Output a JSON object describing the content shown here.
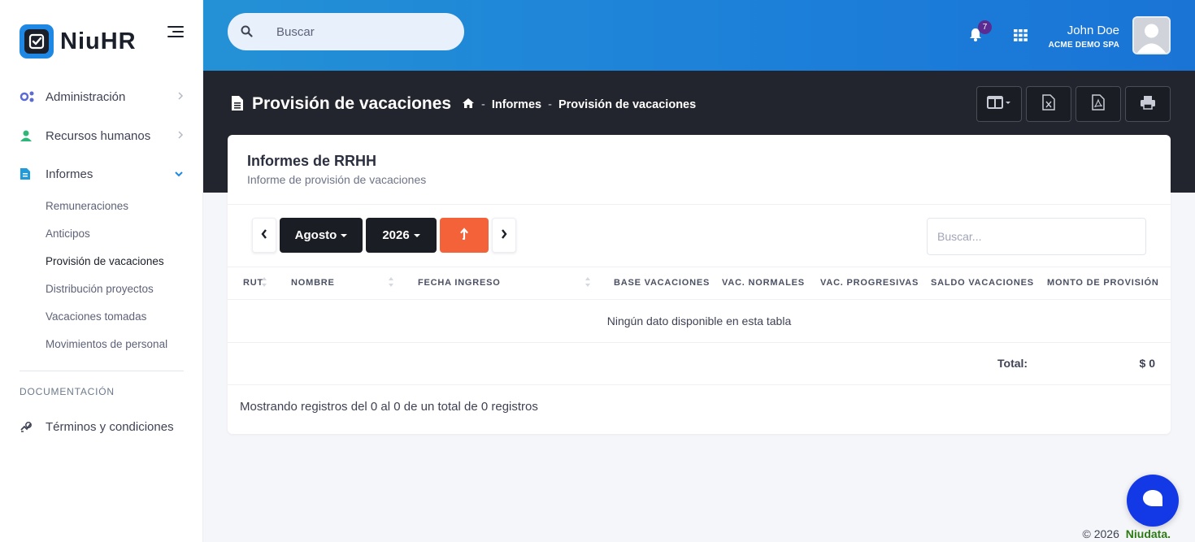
{
  "brand": {
    "name": "NiuHR"
  },
  "search": {
    "placeholder": "Buscar"
  },
  "notifications": {
    "count": "7"
  },
  "user": {
    "name": "John Doe",
    "company": "ACME DEMO SPA"
  },
  "sidebar": {
    "items": [
      {
        "label": "Administración",
        "icon": "gears-icon"
      },
      {
        "label": "Recursos humanos",
        "icon": "user-icon"
      },
      {
        "label": "Informes",
        "icon": "file-icon"
      }
    ],
    "subitems": [
      "Remuneraciones",
      "Anticipos",
      "Provisión de vacaciones",
      "Distribución proyectos",
      "Vacaciones tomadas",
      "Movimientos de personal"
    ],
    "active_subitem": "Provisión de vacaciones",
    "section_title": "DOCUMENTACIÓN",
    "doc_item": "Términos y condiciones"
  },
  "page": {
    "title": "Provisión de vacaciones",
    "breadcrumb": [
      "Informes",
      "Provisión de vacaciones"
    ]
  },
  "card": {
    "title": "Informes de RRHH",
    "subtitle": "Informe de provisión de vacaciones"
  },
  "period": {
    "month": "Agosto",
    "year": "2026"
  },
  "table": {
    "filter_placeholder": "Buscar...",
    "columns": [
      "RUT",
      "NOMBRE",
      "FECHA INGRESO",
      "BASE VACACIONES",
      "VAC. NORMALES",
      "VAC. PROGRESIVAS",
      "SALDO VACACIONES",
      "MONTO DE PROVISIÓN"
    ],
    "empty_message": "Ningún dato disponible en esta tabla",
    "total_label": "Total:",
    "total_value": "$ 0",
    "info": "Mostrando registros del 0 al 0 de un total de 0 registros"
  },
  "footer": {
    "copyright": "© 2026",
    "brand": "Niudata."
  },
  "colors": {
    "accent": "#1f88e5",
    "orange": "#f4623a",
    "dark": "#23252e",
    "chat": "#1338e6",
    "footer_brand": "#2c7a14"
  }
}
